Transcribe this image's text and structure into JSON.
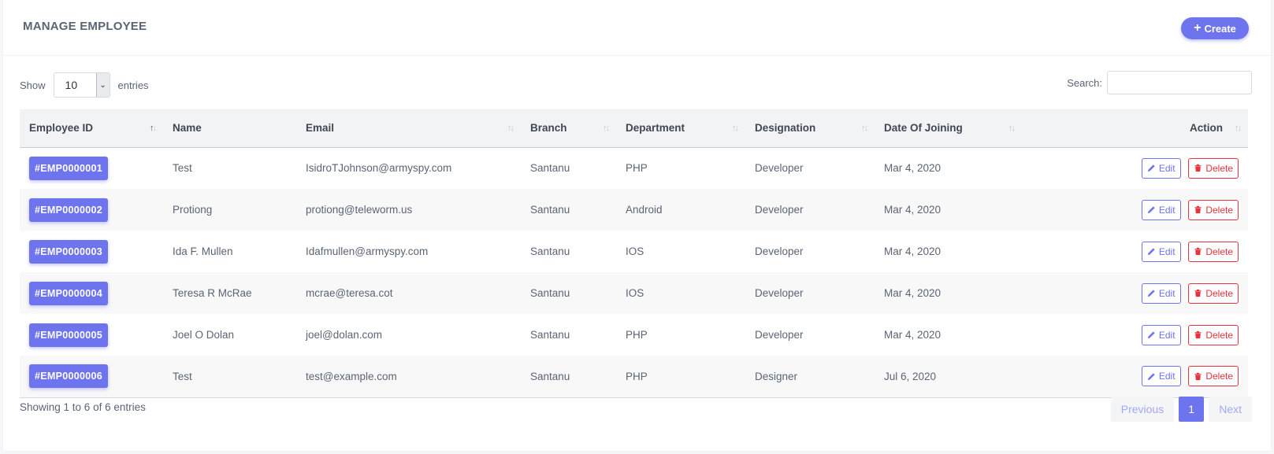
{
  "header": {
    "title": "MANAGE EMPLOYEE",
    "create_label": "Create"
  },
  "length_menu": {
    "prefix": "Show",
    "value": "10",
    "suffix": "entries"
  },
  "search": {
    "label": "Search:",
    "placeholder": ""
  },
  "columns": [
    "Employee ID",
    "Name",
    "Email",
    "Branch",
    "Department",
    "Designation",
    "Date Of Joining",
    "Action"
  ],
  "rows": [
    {
      "id": "#EMP0000001",
      "name": "Test",
      "email": "IsidroTJohnson@armyspy.com",
      "branch": "Santanu",
      "department": "PHP",
      "designation": "Developer",
      "doj": "Mar 4, 2020"
    },
    {
      "id": "#EMP0000002",
      "name": "Protiong",
      "email": "protiong@teleworm.us",
      "branch": "Santanu",
      "department": "Android",
      "designation": "Developer",
      "doj": "Mar 4, 2020"
    },
    {
      "id": "#EMP0000003",
      "name": "Ida F. Mullen",
      "email": "Idafmullen@armyspy.com",
      "branch": "Santanu",
      "department": "IOS",
      "designation": "Developer",
      "doj": "Mar 4, 2020"
    },
    {
      "id": "#EMP0000004",
      "name": "Teresa R McRae",
      "email": "mcrae@teresa.cot",
      "branch": "Santanu",
      "department": "IOS",
      "designation": "Developer",
      "doj": "Mar 4, 2020"
    },
    {
      "id": "#EMP0000005",
      "name": "Joel O Dolan",
      "email": "joel@dolan.com",
      "branch": "Santanu",
      "department": "PHP",
      "designation": "Developer",
      "doj": "Mar 4, 2020"
    },
    {
      "id": "#EMP0000006",
      "name": "Test",
      "email": "test@example.com",
      "branch": "Santanu",
      "department": "PHP",
      "designation": "Designer",
      "doj": "Jul 6, 2020"
    }
  ],
  "actions": {
    "edit_label": "Edit",
    "delete_label": "Delete"
  },
  "footer": {
    "info": "Showing 1 to 6 of 6 entries",
    "previous": "Previous",
    "page": "1",
    "next": "Next"
  },
  "colors": {
    "accent": "#6e73ee",
    "danger": "#e5343d"
  }
}
